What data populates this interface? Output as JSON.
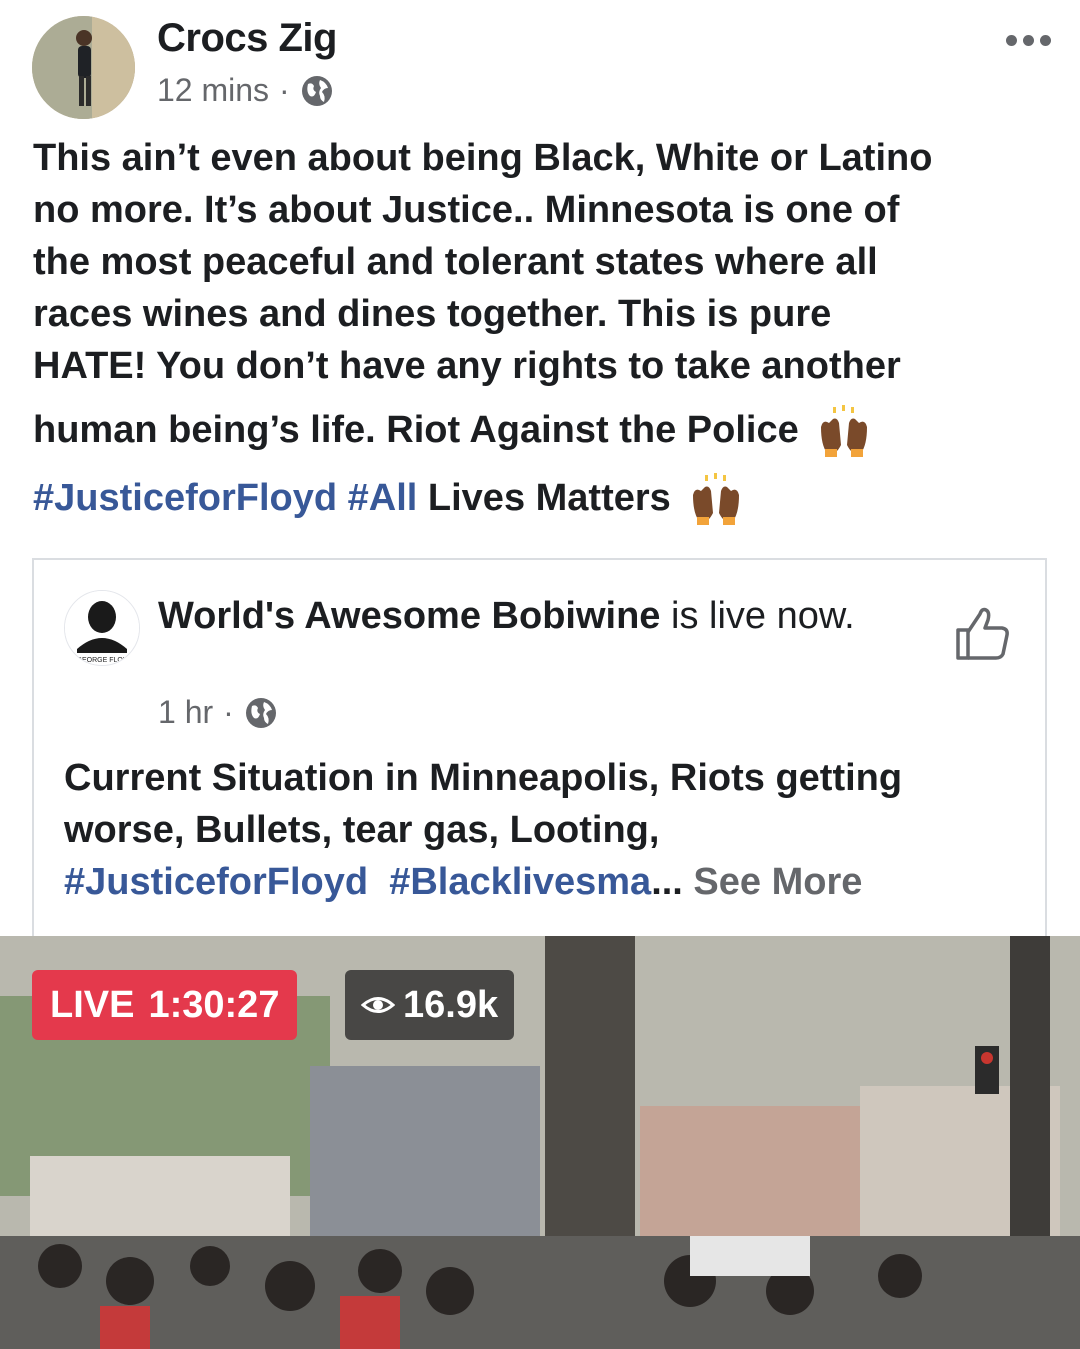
{
  "post": {
    "author": "Crocs Zig",
    "time": "12 mins",
    "separator": "·",
    "text_lines": [
      "This ain’t even about being Black, White or Latino",
      "no more. It’s about Justice.. Minnesota is one of",
      "the most peaceful and tolerant states where all",
      "races wines and dines together. This is pure",
      "HATE! You don’t have any rights to take another",
      "human being’s life. Riot Against the Police"
    ],
    "hashtag1": "#JusticeforFloyd",
    "hashtag2": "#All",
    "tail_text": "Lives Matters",
    "emoji": "raising-hands-emoji"
  },
  "shared": {
    "author": "World's Awesome Bobiwine",
    "status_suffix": " is live now.",
    "avatar_caption": "GEORGE FLOY",
    "time": "1 hr",
    "separator": "·",
    "text_line1": "Current Situation in Minneapolis, Riots getting",
    "text_line2": "worse, Bullets, tear gas, Looting,",
    "hashtag1": "#JusticeforFloyd",
    "hashtag2": "#Blacklivesma",
    "ellipsis": "... ",
    "see_more": "See More",
    "like_icon": "thumbs-up-icon"
  },
  "video": {
    "live_label": "LIVE",
    "duration": "1:30:27",
    "views": "16.9k",
    "views_icon": "eye-icon",
    "live_color": "#e4394c"
  },
  "colors": {
    "link": "#385898",
    "meta": "#65676b"
  }
}
